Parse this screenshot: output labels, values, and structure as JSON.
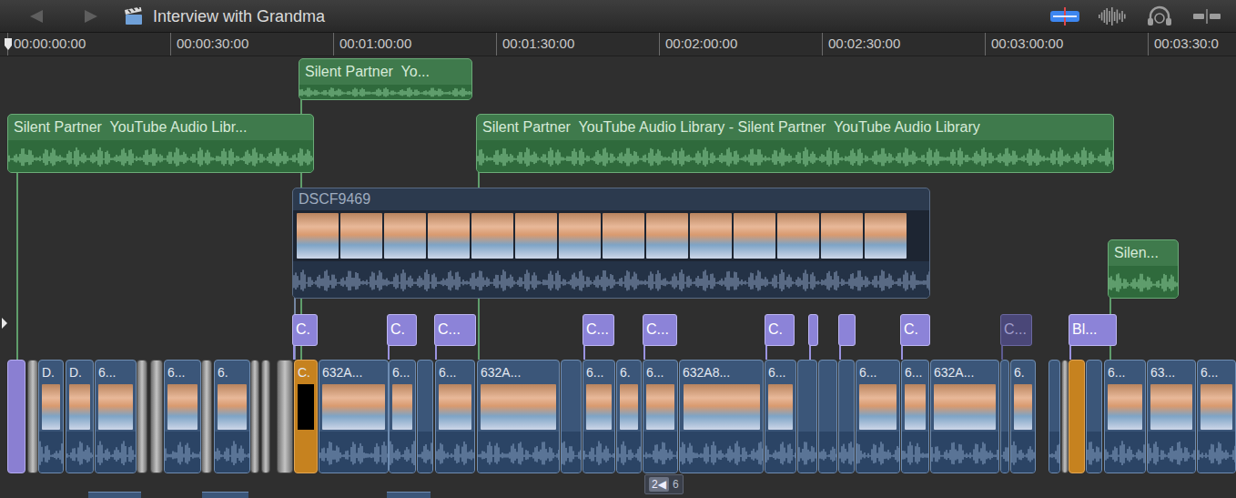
{
  "window": {
    "title": "Interview with Grandma"
  },
  "toolbar_buttons": [
    {
      "on": true
    },
    {
      "on": false
    },
    {
      "on": false
    },
    {
      "on": false
    }
  ],
  "ruler": {
    "ticks": [
      "00:00:00:00",
      "00:00:30:00",
      "00:01:00:00",
      "00:01:30:00",
      "00:02:00:00",
      "00:02:30:00",
      "00:03:00:00",
      "00:03:30:0"
    ]
  },
  "audio_clips": [
    {
      "title": "Silent Partner  Yo..."
    },
    {
      "title": "Silent Partner  YouTube Audio Libr..."
    },
    {
      "title": "Silent Partner  YouTube Audio Library - Silent Partner  YouTube Audio Library"
    },
    {
      "title": "Silen..."
    }
  ],
  "connected_video": {
    "title": "DSCF9469"
  },
  "titles": [
    {
      "label": "C.",
      "disabled": false
    },
    {
      "label": "C.",
      "disabled": false
    },
    {
      "label": "C...",
      "disabled": false
    },
    {
      "label": "C...",
      "disabled": false
    },
    {
      "label": "C...",
      "disabled": false
    },
    {
      "label": "C.",
      "disabled": false
    },
    {
      "label": "",
      "disabled": false
    },
    {
      "label": "",
      "disabled": false
    },
    {
      "label": "C.",
      "disabled": false
    },
    {
      "label": "C...",
      "disabled": true
    },
    {
      "label": "Bl...",
      "disabled": false
    }
  ],
  "storyline": [
    {
      "kind": "title",
      "label": ""
    },
    {
      "kind": "transition"
    },
    {
      "kind": "video",
      "label": "D."
    },
    {
      "kind": "video",
      "label": "D."
    },
    {
      "kind": "video",
      "label": "6..."
    },
    {
      "kind": "transition"
    },
    {
      "kind": "transition"
    },
    {
      "kind": "video",
      "label": "6..."
    },
    {
      "kind": "transition"
    },
    {
      "kind": "video",
      "label": "6."
    },
    {
      "kind": "transition"
    },
    {
      "kind": "transition"
    },
    {
      "kind": "transition"
    },
    {
      "kind": "generator",
      "label": "C."
    },
    {
      "kind": "video",
      "label": "632A..."
    },
    {
      "kind": "video",
      "label": "6..."
    },
    {
      "kind": "video",
      "label": ""
    },
    {
      "kind": "video",
      "label": "6..."
    },
    {
      "kind": "video",
      "label": "632A..."
    },
    {
      "kind": "video",
      "label": ""
    },
    {
      "kind": "video",
      "label": "6..."
    },
    {
      "kind": "video",
      "label": "6."
    },
    {
      "kind": "video",
      "label": "6..."
    },
    {
      "kind": "video",
      "label": "632A8..."
    },
    {
      "kind": "video",
      "label": "6..."
    },
    {
      "kind": "video",
      "label": ""
    },
    {
      "kind": "video",
      "label": ""
    },
    {
      "kind": "video",
      "label": ""
    },
    {
      "kind": "video",
      "label": "6..."
    },
    {
      "kind": "video",
      "label": "6..."
    },
    {
      "kind": "video",
      "label": "632A..."
    },
    {
      "kind": "video",
      "label": ""
    },
    {
      "kind": "video",
      "label": "6."
    },
    {
      "kind": "video",
      "label": ""
    },
    {
      "kind": "transition"
    },
    {
      "kind": "generator",
      "label": ""
    },
    {
      "kind": "video",
      "label": ""
    },
    {
      "kind": "video",
      "label": "6..."
    },
    {
      "kind": "video",
      "label": "63..."
    },
    {
      "kind": "video",
      "label": "6..."
    }
  ],
  "bottom_badge": {
    "icon": "2◀",
    "label": "6"
  }
}
